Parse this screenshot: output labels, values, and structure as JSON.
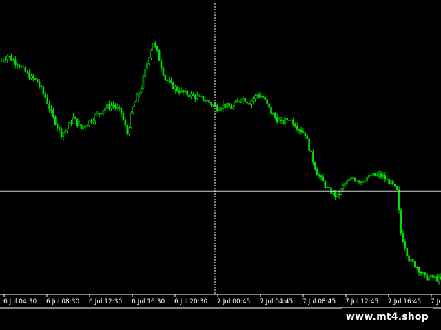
{
  "chart_data": {
    "type": "candlestick",
    "x_tick_labels": [
      "6 Jul 04:30",
      "6 Jul 08:30",
      "6 Jul 12:30",
      "6 Jul 16:30",
      "6 Jul 20:30",
      "7 Jul 00:45",
      "7 Jul 04:45",
      "7 Jul 08:45",
      "7 Jul 12:45",
      "7 Jul 16:45",
      "7 Jul"
    ],
    "ylim": [
      0,
      100
    ],
    "crosshair": {
      "x_index": 5,
      "y_value": 36
    },
    "colors": {
      "bull": "#00e000",
      "bear": "#00e000",
      "axis": "#ffffff",
      "crosshair": "#ffffff",
      "background": "#000000"
    },
    "close_path": [
      [
        0,
        86
      ],
      [
        3,
        88
      ],
      [
        8,
        85
      ],
      [
        14,
        80
      ],
      [
        18,
        78
      ],
      [
        22,
        72
      ],
      [
        26,
        64
      ],
      [
        30,
        58
      ],
      [
        33,
        60
      ],
      [
        36,
        64
      ],
      [
        40,
        60
      ],
      [
        46,
        64
      ],
      [
        52,
        68
      ],
      [
        56,
        69
      ],
      [
        60,
        66
      ],
      [
        63,
        58
      ],
      [
        66,
        68
      ],
      [
        70,
        76
      ],
      [
        74,
        88
      ],
      [
        76,
        93
      ],
      [
        78,
        89
      ],
      [
        82,
        79
      ],
      [
        86,
        76
      ],
      [
        90,
        74
      ],
      [
        94,
        73
      ],
      [
        98,
        72
      ],
      [
        102,
        71
      ],
      [
        106,
        69
      ],
      [
        108,
        68
      ],
      [
        111,
        69
      ],
      [
        116,
        68
      ],
      [
        120,
        72
      ],
      [
        124,
        70
      ],
      [
        128,
        73
      ],
      [
        131,
        72
      ],
      [
        135,
        66
      ],
      [
        140,
        62
      ],
      [
        144,
        64
      ],
      [
        149,
        60
      ],
      [
        152,
        58
      ],
      [
        155,
        50
      ],
      [
        158,
        43
      ],
      [
        163,
        37
      ],
      [
        168,
        34
      ],
      [
        172,
        39
      ],
      [
        176,
        41
      ],
      [
        180,
        40
      ],
      [
        185,
        42
      ],
      [
        190,
        42
      ],
      [
        195,
        39
      ],
      [
        198,
        36
      ],
      [
        200,
        20
      ],
      [
        202,
        15
      ],
      [
        204,
        10
      ],
      [
        208,
        7
      ],
      [
        212,
        3
      ],
      [
        216,
        3
      ],
      [
        220,
        2
      ]
    ]
  },
  "watermark": {
    "text": "www.mt4.shop"
  }
}
